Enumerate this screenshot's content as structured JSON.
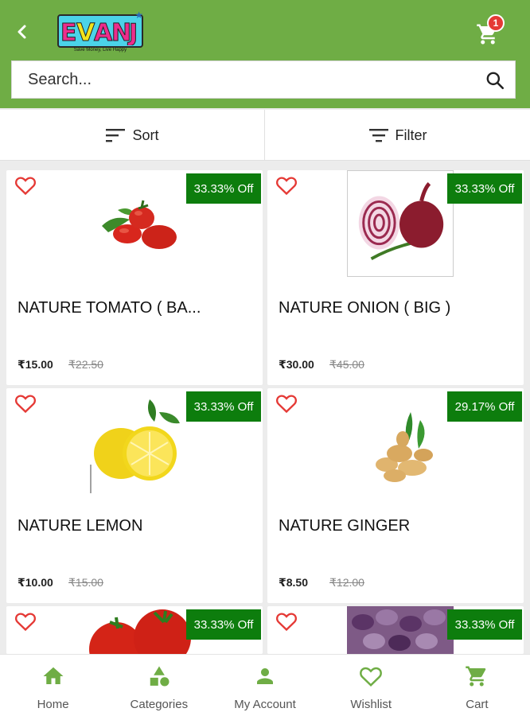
{
  "header": {
    "logo_text": "EVANJ",
    "logo_tagline": "Save Money, Live Happy",
    "cart_count": "1",
    "brand_color": "#6fad45"
  },
  "search": {
    "placeholder": "Search..."
  },
  "sortbar": {
    "sort_label": "Sort",
    "filter_label": "Filter"
  },
  "products": [
    {
      "name": "NATURE TOMATO ( BA...",
      "price": "₹15.00",
      "mrp": "₹22.50",
      "discount": "33.33% Off",
      "image": "tomato"
    },
    {
      "name": "NATURE ONION ( BIG )",
      "price": "₹30.00",
      "mrp": "₹45.00",
      "discount": "33.33% Off",
      "image": "onion"
    },
    {
      "name": "NATURE LEMON",
      "price": "₹10.00",
      "mrp": "₹15.00",
      "discount": "33.33% Off",
      "image": "lemon"
    },
    {
      "name": "NATURE GINGER",
      "price": "₹8.50",
      "mrp": "₹12.00",
      "discount": "29.17% Off",
      "image": "ginger"
    },
    {
      "discount": "33.33% Off",
      "image": "tomato"
    },
    {
      "discount": "33.33% Off",
      "image": "brinjal"
    }
  ],
  "bottom_nav": [
    {
      "label": "Home",
      "icon": "home-icon"
    },
    {
      "label": "Categories",
      "icon": "categories-icon"
    },
    {
      "label": "My Account",
      "icon": "account-icon"
    },
    {
      "label": "Wishlist",
      "icon": "heart-icon"
    },
    {
      "label": "Cart",
      "icon": "cart-icon"
    }
  ],
  "colors": {
    "accent": "#6fad45",
    "discount_badge": "#0d7d0d",
    "cart_badge": "#e53935",
    "heart": "#e53935"
  }
}
